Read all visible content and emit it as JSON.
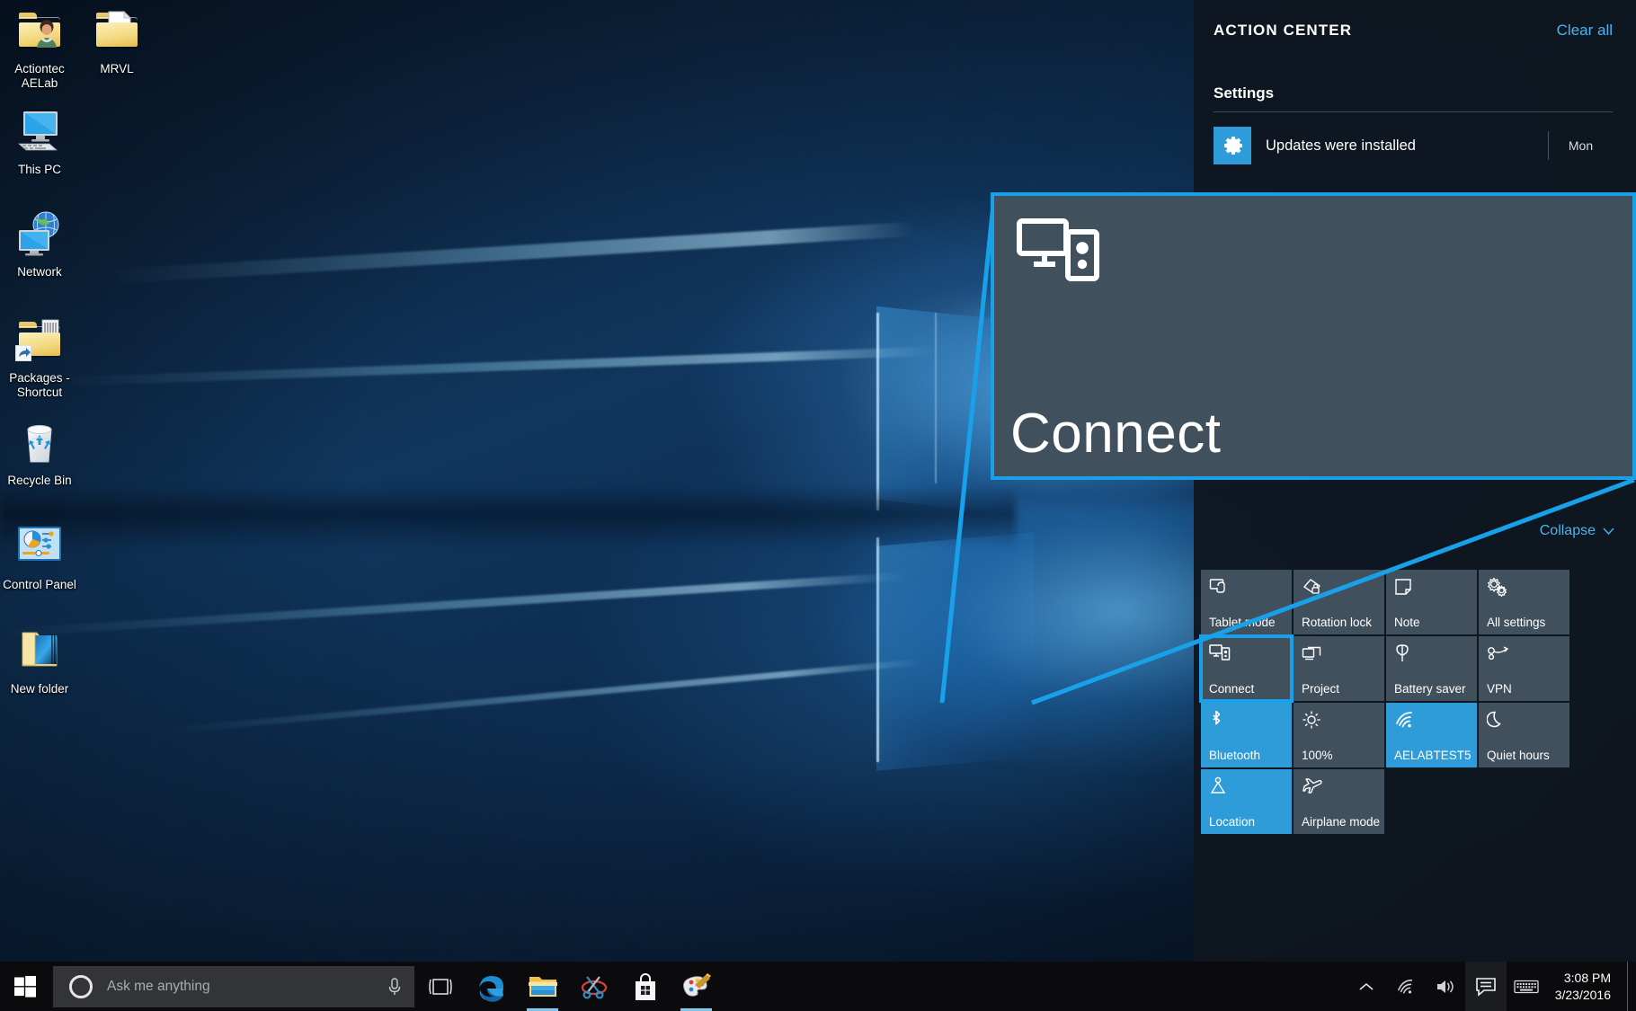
{
  "desktop": {
    "icons": [
      {
        "label": "Actiontec AELab",
        "icon": "folder-user-icon"
      },
      {
        "label": "MRVL",
        "icon": "folder-document-icon"
      },
      {
        "label": "This PC",
        "icon": "this-pc-icon"
      },
      {
        "label": "Network",
        "icon": "network-icon"
      },
      {
        "label": "Packages - Shortcut",
        "icon": "folder-shortcut-icon"
      },
      {
        "label": "Recycle Bin",
        "icon": "recycle-bin-icon"
      },
      {
        "label": "Control Panel",
        "icon": "control-panel-icon"
      },
      {
        "label": "New folder",
        "icon": "folder-open-icon"
      }
    ]
  },
  "action_center": {
    "title": "ACTION CENTER",
    "clear_all": "Clear all",
    "section_label": "Settings",
    "notification": {
      "text": "Updates were installed",
      "time": "Mon",
      "icon": "gear-icon"
    },
    "collapse_label": "Collapse",
    "accent_color": "#18a0e8",
    "tile_off_color": "#41505d",
    "tile_on_color": "#2d9cd8",
    "tiles": [
      {
        "label": "Tablet mode",
        "icon": "tablet-mode-icon",
        "state": "off"
      },
      {
        "label": "Rotation lock",
        "icon": "rotation-lock-icon",
        "state": "off"
      },
      {
        "label": "Note",
        "icon": "note-icon",
        "state": "off"
      },
      {
        "label": "All settings",
        "icon": "all-settings-icon",
        "state": "off"
      },
      {
        "label": "Connect",
        "icon": "connect-icon",
        "state": "off",
        "selected": true
      },
      {
        "label": "Project",
        "icon": "project-icon",
        "state": "off"
      },
      {
        "label": "Battery saver",
        "icon": "battery-saver-icon",
        "state": "off"
      },
      {
        "label": "VPN",
        "icon": "vpn-icon",
        "state": "off"
      },
      {
        "label": "Bluetooth",
        "icon": "bluetooth-icon",
        "state": "on"
      },
      {
        "label": "100%",
        "icon": "brightness-icon",
        "state": "off"
      },
      {
        "label": "AELABTEST5",
        "icon": "wifi-icon",
        "state": "on"
      },
      {
        "label": "Quiet hours",
        "icon": "moon-icon",
        "state": "off"
      },
      {
        "label": "Location",
        "icon": "location-icon",
        "state": "on"
      },
      {
        "label": "Airplane mode",
        "icon": "airplane-icon",
        "state": "off"
      }
    ]
  },
  "callout": {
    "label": "Connect",
    "icon": "connect-icon",
    "border_color": "#18a0e8"
  },
  "taskbar": {
    "start_icon": "windows-logo-icon",
    "search": {
      "placeholder": "Ask me anything",
      "cortana_icon": "cortana-circle-icon",
      "mic_icon": "microphone-icon"
    },
    "pinned": [
      {
        "name": "task-view",
        "icon": "task-view-icon",
        "active": false
      },
      {
        "name": "microsoft-edge",
        "icon": "edge-icon",
        "active": false
      },
      {
        "name": "file-explorer",
        "icon": "file-explorer-icon",
        "active": true
      },
      {
        "name": "snipping-tool",
        "icon": "snipping-tool-icon",
        "active": false
      },
      {
        "name": "microsoft-store",
        "icon": "store-icon",
        "active": false
      },
      {
        "name": "paint",
        "icon": "paint-icon",
        "active": true
      }
    ],
    "tray": [
      {
        "name": "show-hidden-icons",
        "icon": "chevron-up-icon"
      },
      {
        "name": "network",
        "icon": "wifi-icon"
      },
      {
        "name": "volume",
        "icon": "speaker-icon"
      },
      {
        "name": "action-center",
        "icon": "action-center-icon"
      },
      {
        "name": "touch-keyboard",
        "icon": "keyboard-icon"
      }
    ],
    "clock": {
      "time": "3:08 PM",
      "date": "3/23/2016"
    }
  }
}
